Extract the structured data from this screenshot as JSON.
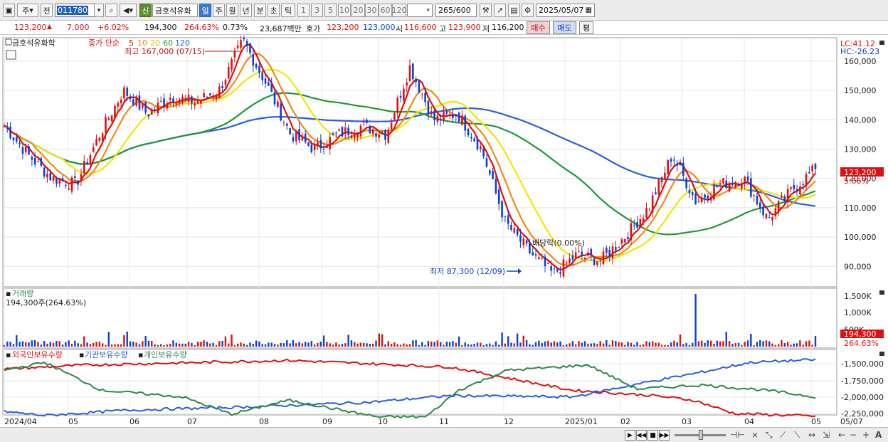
{
  "toolbar": {
    "period": "주",
    "prev": "전",
    "code": "011780",
    "badge": "신",
    "name": "금호석유화",
    "periods": [
      "일",
      "주",
      "월",
      "년",
      "분",
      "초",
      "틱"
    ],
    "active_period": "일",
    "intervals": [
      "1",
      "3",
      "5",
      "10",
      "20",
      "30",
      "60",
      "120"
    ],
    "count": "265",
    "count_total": "/600",
    "date": "2025/05/07"
  },
  "info": {
    "price": "123,200",
    "change": "7,000",
    "change_pct": "+6.02%",
    "volume": "194,300",
    "volume_ratio": "264.63%",
    "turnover": "0.73%",
    "amount": "23,687백만",
    "quote_label": "호가",
    "ask": "123,200",
    "bid": "123,000",
    "open_label": "시",
    "open": "116,600",
    "high_label": "고",
    "high": "123,900",
    "low_label": "저",
    "low": "116,200",
    "buy_label": "매수",
    "sell_label": "매도",
    "eval_label": "평"
  },
  "colors": {
    "up": "#e01010",
    "down": "#1040d0",
    "ma5": "#e01010",
    "ma10": "#f08a10",
    "ma20": "#f2e600",
    "ma60": "#1d9a35",
    "ma120": "#2a5fe0",
    "foreign": "#e01010",
    "institution": "#2a5fe0",
    "individual": "#2a8a4a"
  },
  "price_panel": {
    "stock_label": "금호석유화학",
    "ma_label": "종가 단순",
    "ma_periods": [
      "5",
      "10",
      "20",
      "60",
      "120"
    ],
    "lc": "LC:41.12",
    "hc": "HC:-26.23",
    "high_note": "최고 167,000 (07/15)",
    "low_note": "최저 87,300 (12/09)",
    "ex_note": "배당락(0.00%)",
    "last_price": "123,200",
    "last_pct": "5.66%",
    "y_ticks": [
      "160,000",
      "150,000",
      "140,000",
      "130,000",
      "120,000",
      "110,000",
      "100,000",
      "90,000"
    ]
  },
  "volume_panel": {
    "title": "거래량",
    "value": "194,300주(264.63%)",
    "y_ticks": [
      "1,500K",
      "1,000K",
      "500K"
    ],
    "last": "194,300",
    "last_pct": "264.63%"
  },
  "holding_panel": {
    "titles": [
      "외국인보유수량",
      "기관보유수량",
      "개인보유수량"
    ],
    "y_ticks": [
      "-1,500,000",
      "-1,750,000",
      "-2,000,000",
      "-2,250,000"
    ]
  },
  "x_axis": {
    "labels": [
      "2024/04",
      "05",
      "06",
      "07",
      "08",
      "09",
      "10",
      "11",
      "12",
      "2025/01",
      "02",
      "03",
      "04",
      "05"
    ],
    "right_label": "05/07"
  },
  "chart_data": {
    "type": "candlestick",
    "series": [
      {
        "name": "MA 5",
        "note": "red"
      },
      {
        "name": "MA 10",
        "note": "orange"
      },
      {
        "name": "MA 20",
        "note": "yellow"
      },
      {
        "name": "MA 60",
        "note": "green"
      },
      {
        "name": "MA 120",
        "note": "blue"
      }
    ],
    "close_path": [
      [
        "2024/04",
        138000
      ],
      [
        "2024/04",
        128000
      ],
      [
        "2024/04",
        120000
      ],
      [
        "2024/05",
        118000
      ],
      [
        "2024/05",
        135000
      ],
      [
        "2024/05",
        150000
      ],
      [
        "2024/06",
        142000
      ],
      [
        "2024/06",
        148000
      ],
      [
        "2024/06",
        146000
      ],
      [
        "2024/07",
        150000
      ],
      [
        "2024/07",
        167000
      ],
      [
        "2024/07",
        152000
      ],
      [
        "2024/08",
        135000
      ],
      [
        "2024/08",
        130000
      ],
      [
        "2024/09",
        135000
      ],
      [
        "2024/09",
        138000
      ],
      [
        "2024/09",
        135000
      ],
      [
        "2024/10",
        158000
      ],
      [
        "2024/10",
        140000
      ],
      [
        "2024/11",
        142000
      ],
      [
        "2024/11",
        130000
      ],
      [
        "2024/11",
        105000
      ],
      [
        "2024/12",
        95000
      ],
      [
        "2024/12",
        87300
      ],
      [
        "2024/12",
        94000
      ],
      [
        "2025/01",
        92000
      ],
      [
        "2025/01",
        100000
      ],
      [
        "2025/02",
        110000
      ],
      [
        "2025/02",
        128000
      ],
      [
        "2025/03",
        112000
      ],
      [
        "2025/03",
        118000
      ],
      [
        "2025/04",
        120000
      ],
      [
        "2025/04",
        106000
      ],
      [
        "2025/04",
        116000
      ],
      [
        "2025/05",
        123200
      ]
    ],
    "ylim": [
      84000,
      167000
    ],
    "high": 167000,
    "low": 87300
  }
}
